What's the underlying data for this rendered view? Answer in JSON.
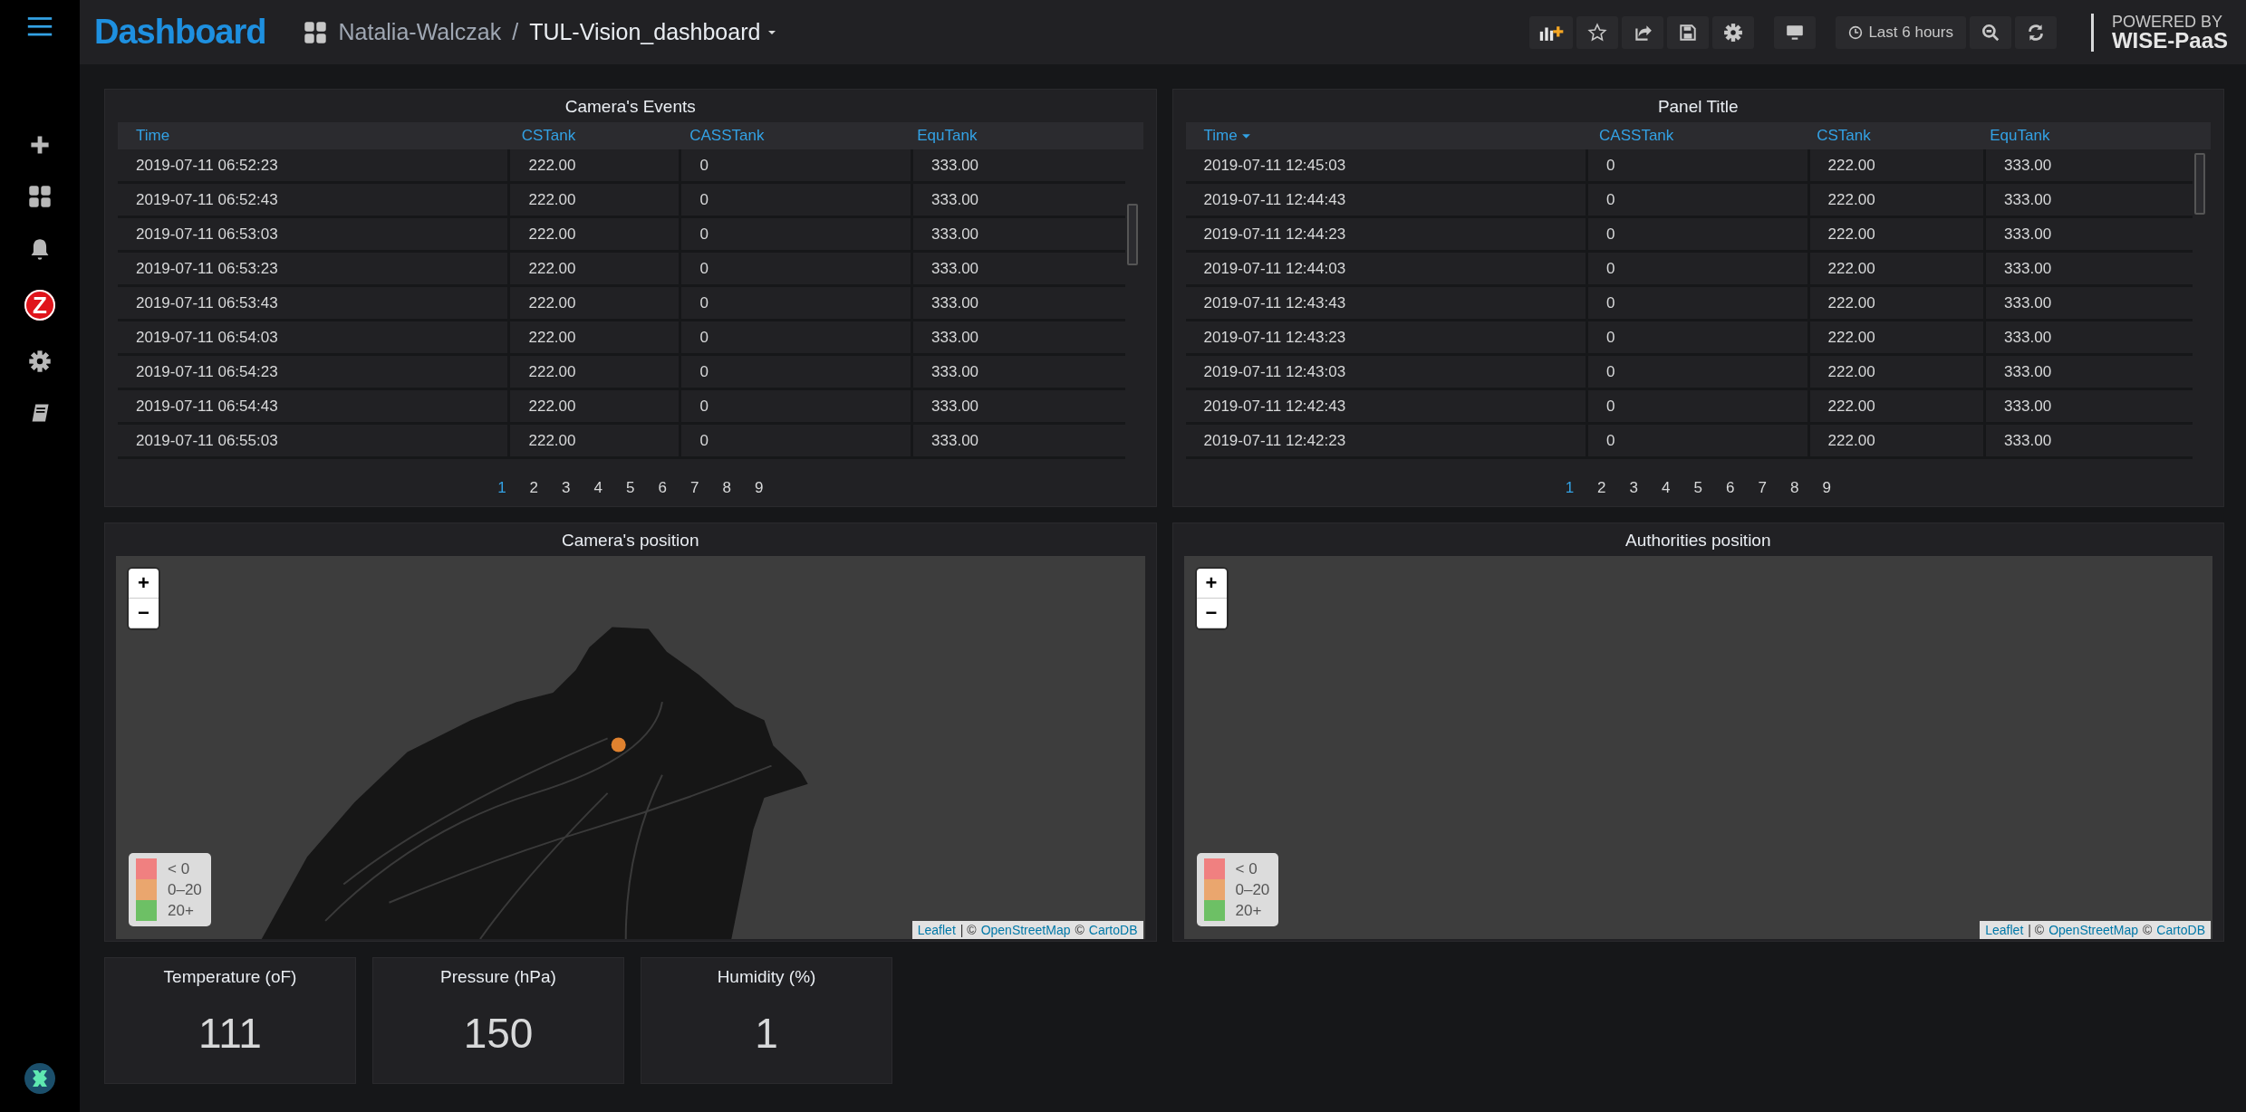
{
  "sidebar": {
    "items": [
      {
        "kind": "plus"
      },
      {
        "kind": "dashboards"
      },
      {
        "kind": "alerts"
      },
      {
        "kind": "app",
        "label": "Z"
      },
      {
        "kind": "settings"
      },
      {
        "kind": "docs"
      }
    ]
  },
  "topbar": {
    "brand": "Dashboard",
    "folder": "Natalia-Walczak",
    "separator": "/",
    "dashboard": "TUL-Vision_dashboard",
    "tools": [
      {
        "kind": "add-panel"
      },
      {
        "kind": "star"
      },
      {
        "kind": "share"
      },
      {
        "kind": "save"
      },
      {
        "kind": "settings"
      },
      {
        "kind": "tv"
      }
    ],
    "time_range": "Last 6 hours",
    "actions": [
      {
        "kind": "zoom-out"
      },
      {
        "kind": "refresh"
      }
    ],
    "logo": {
      "line_1": "POWERED BY",
      "line_2": "WISE-PaaS"
    }
  },
  "tables": [
    {
      "title": "Camera's Events",
      "columns": [
        {
          "label": "Time",
          "sorted": false
        },
        {
          "label": "CSTank",
          "sorted": false
        },
        {
          "label": "CASSTank",
          "sorted": false
        },
        {
          "label": "EquTank",
          "sorted": false
        }
      ],
      "rows": [
        [
          "2019-07-11 06:52:23",
          "222.00",
          "0",
          "333.00"
        ],
        [
          "2019-07-11 06:52:43",
          "222.00",
          "0",
          "333.00"
        ],
        [
          "2019-07-11 06:53:03",
          "222.00",
          "0",
          "333.00"
        ],
        [
          "2019-07-11 06:53:23",
          "222.00",
          "0",
          "333.00"
        ],
        [
          "2019-07-11 06:53:43",
          "222.00",
          "0",
          "333.00"
        ],
        [
          "2019-07-11 06:54:03",
          "222.00",
          "0",
          "333.00"
        ],
        [
          "2019-07-11 06:54:23",
          "222.00",
          "0",
          "333.00"
        ],
        [
          "2019-07-11 06:54:43",
          "222.00",
          "0",
          "333.00"
        ],
        [
          "2019-07-11 06:55:03",
          "222.00",
          "0",
          "333.00"
        ]
      ],
      "pages": [
        {
          "label": "1",
          "selected": true
        },
        {
          "label": "2",
          "selected": false
        },
        {
          "label": "3",
          "selected": false
        },
        {
          "label": "4",
          "selected": false
        },
        {
          "label": "5",
          "selected": false
        },
        {
          "label": "6",
          "selected": false
        },
        {
          "label": "7",
          "selected": false
        },
        {
          "label": "8",
          "selected": false
        },
        {
          "label": "9",
          "selected": false
        }
      ]
    },
    {
      "title": "Panel Title",
      "columns": [
        {
          "label": "Time",
          "sorted": true
        },
        {
          "label": "CASSTank",
          "sorted": false
        },
        {
          "label": "CSTank",
          "sorted": false
        },
        {
          "label": "EquTank",
          "sorted": false
        }
      ],
      "rows": [
        [
          "2019-07-11 12:45:03",
          "0",
          "222.00",
          "333.00"
        ],
        [
          "2019-07-11 12:44:43",
          "0",
          "222.00",
          "333.00"
        ],
        [
          "2019-07-11 12:44:23",
          "0",
          "222.00",
          "333.00"
        ],
        [
          "2019-07-11 12:44:03",
          "0",
          "222.00",
          "333.00"
        ],
        [
          "2019-07-11 12:43:43",
          "0",
          "222.00",
          "333.00"
        ],
        [
          "2019-07-11 12:43:23",
          "0",
          "222.00",
          "333.00"
        ],
        [
          "2019-07-11 12:43:03",
          "0",
          "222.00",
          "333.00"
        ],
        [
          "2019-07-11 12:42:43",
          "0",
          "222.00",
          "333.00"
        ],
        [
          "2019-07-11 12:42:23",
          "0",
          "222.00",
          "333.00"
        ]
      ],
      "pages": [
        {
          "label": "1",
          "selected": true
        },
        {
          "label": "2",
          "selected": false
        },
        {
          "label": "3",
          "selected": false
        },
        {
          "label": "4",
          "selected": false
        },
        {
          "label": "5",
          "selected": false
        },
        {
          "label": "6",
          "selected": false
        },
        {
          "label": "7",
          "selected": false
        },
        {
          "label": "8",
          "selected": false
        },
        {
          "label": "9",
          "selected": false
        }
      ]
    }
  ],
  "maps": [
    {
      "title": "Camera's position",
      "kind": "land",
      "zoom_in": "+",
      "zoom_out": "−",
      "legend": [
        {
          "label": "< 0",
          "color": "#f08080"
        },
        {
          "label": "0–20",
          "color": "#eaa66e"
        },
        {
          "label": "20+",
          "color": "#6dc065"
        }
      ],
      "attribution": [
        {
          "text": "Leaflet",
          "kind": "link"
        },
        {
          "text": "| ©",
          "kind": "text"
        },
        {
          "text": "OpenStreetMap",
          "kind": "link"
        },
        {
          "text": "©",
          "kind": "text"
        },
        {
          "text": "CartoDB",
          "kind": "link"
        }
      ]
    },
    {
      "title": "Authorities position",
      "kind": "empty",
      "zoom_in": "+",
      "zoom_out": "−",
      "legend": [
        {
          "label": "< 0",
          "color": "#f08080"
        },
        {
          "label": "0–20",
          "color": "#eaa66e"
        },
        {
          "label": "20+",
          "color": "#6dc065"
        }
      ],
      "attribution": [
        {
          "text": "Leaflet",
          "kind": "link"
        },
        {
          "text": "| ©",
          "kind": "text"
        },
        {
          "text": "OpenStreetMap",
          "kind": "link"
        },
        {
          "text": "©",
          "kind": "text"
        },
        {
          "text": "CartoDB",
          "kind": "link"
        }
      ]
    }
  ],
  "stats": [
    {
      "title": "Temperature (oF)",
      "value": "111"
    },
    {
      "title": "Pressure (hPa)",
      "value": "150"
    },
    {
      "title": "Humidity (%)",
      "value": "1"
    }
  ]
}
